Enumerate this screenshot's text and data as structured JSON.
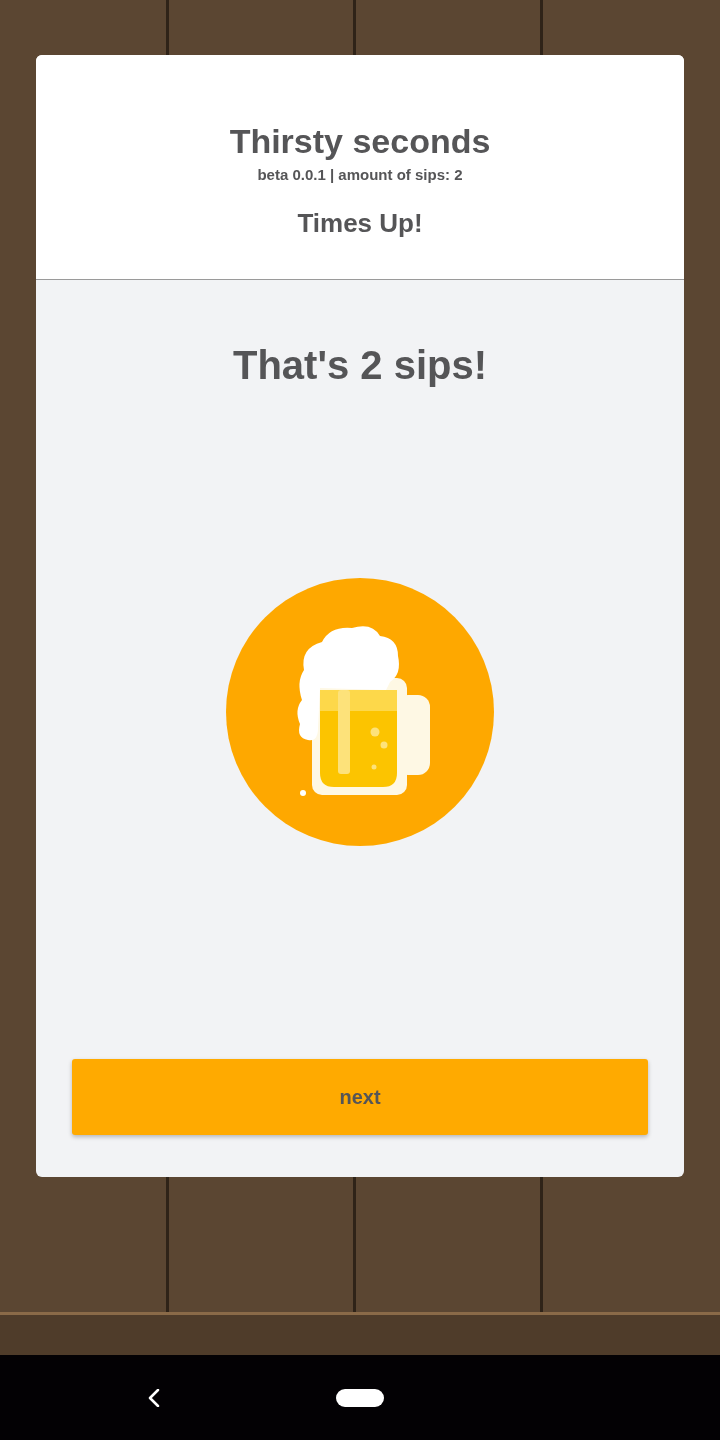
{
  "header": {
    "title": "Thirsty seconds",
    "subtitle": "beta 0.0.1 | amount of sips: 2",
    "status": "Times Up!"
  },
  "result": {
    "message": "That's 2 sips!"
  },
  "buttons": [
    {
      "label": "next"
    }
  ]
}
